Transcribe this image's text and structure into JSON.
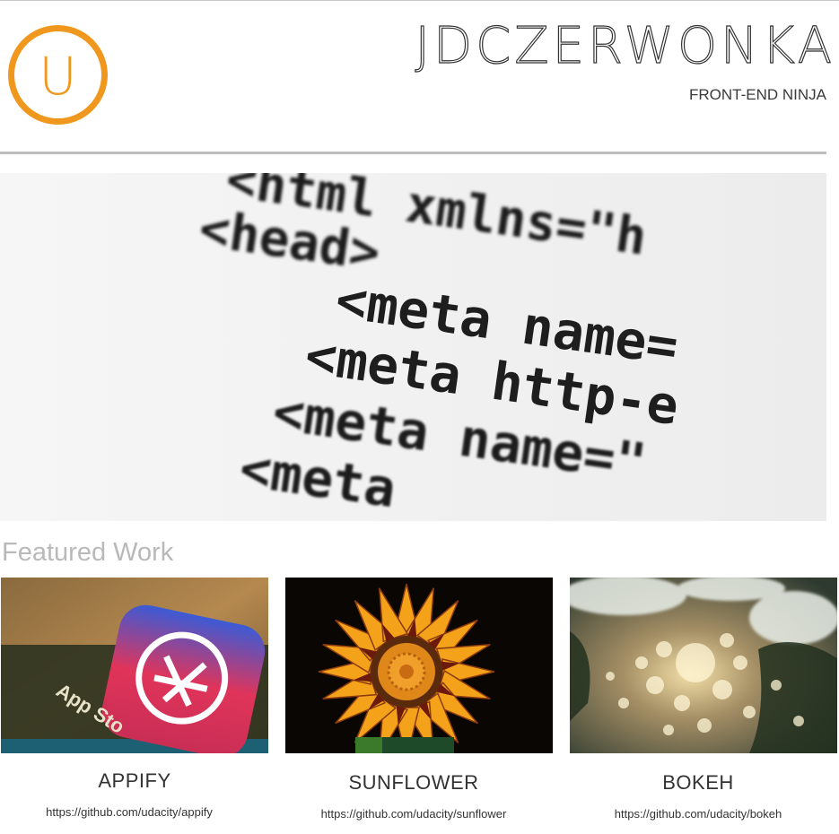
{
  "header": {
    "brand": "JDCZERWONKA",
    "tagline": "FRONT-END NINJA",
    "logo_letter": "U",
    "logo_color": "#f0981e"
  },
  "hero": {
    "code_lines": [
      "<html  xmlns=\"h",
      "<head>",
      "<meta name=",
      "<meta http-e",
      "<meta name=\"",
      "<meta"
    ]
  },
  "featured": {
    "title": "Featured Work",
    "projects": [
      {
        "title": "APPIFY",
        "link": "https://github.com/udacity/appify",
        "image_icon": "app-store-icon"
      },
      {
        "title": "SUNFLOWER",
        "link": "https://github.com/udacity/sunflower",
        "image_icon": "sunflower-photo"
      },
      {
        "title": "BOKEH",
        "link": "https://github.com/udacity/bokeh",
        "image_icon": "bokeh-photo"
      }
    ]
  },
  "colors": {
    "accent": "#f0981e",
    "rule": "#bdbdbd",
    "muted_heading": "#b9b9b9",
    "text": "#333333"
  }
}
